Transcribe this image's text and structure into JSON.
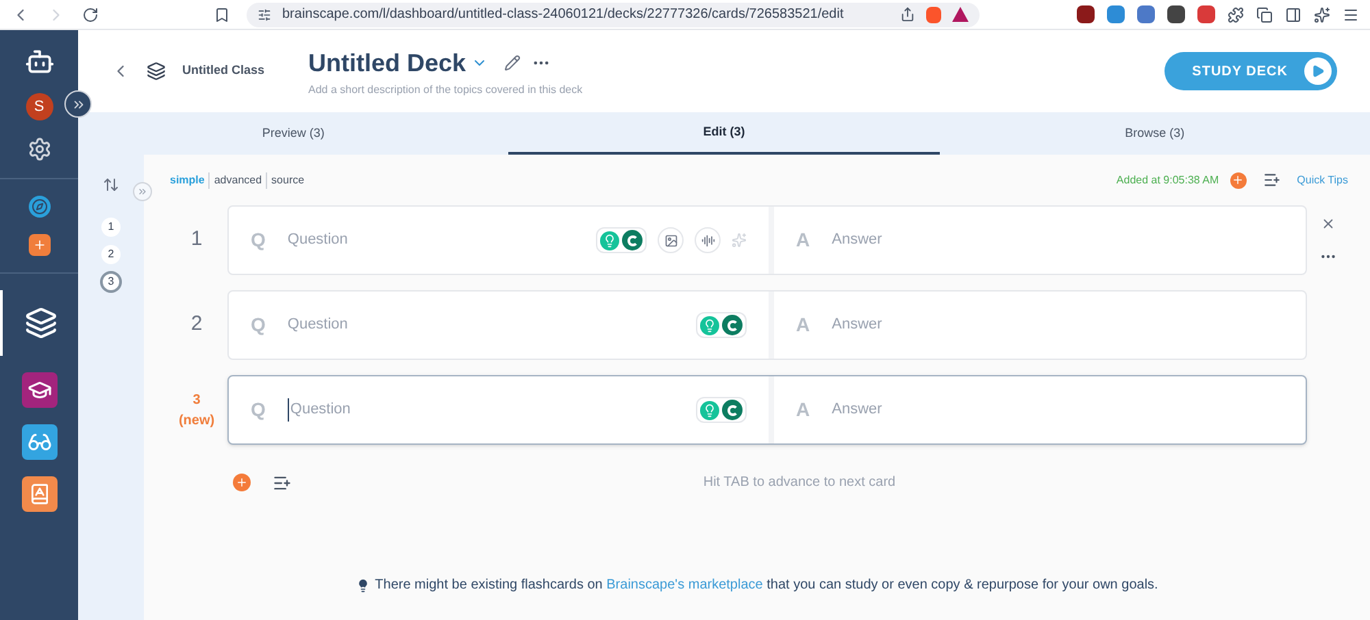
{
  "browser": {
    "url": "brainscape.com/l/dashboard/untitled-class-24060121/decks/22777326/cards/726583521/edit"
  },
  "sidebar": {
    "avatar": "S"
  },
  "header": {
    "class_name": "Untitled Class",
    "deck_title": "Untitled Deck",
    "description_placeholder": "Add a short description of the topics covered in this deck",
    "study_button": "STUDY DECK"
  },
  "tabs": [
    {
      "label": "Preview (3)",
      "selected": false
    },
    {
      "label": "Edit (3)",
      "selected": true
    },
    {
      "label": "Browse (3)",
      "selected": false
    }
  ],
  "editor_modes": [
    {
      "label": "simple",
      "selected": true
    },
    {
      "label": "advanced",
      "selected": false
    },
    {
      "label": "source",
      "selected": false
    }
  ],
  "saved_status": "Added at 9:05:38 AM",
  "quick_tips": "Quick Tips",
  "card_nav": [
    {
      "label": "1",
      "selected": false
    },
    {
      "label": "2",
      "selected": false
    },
    {
      "label": "3",
      "selected": true
    }
  ],
  "cards": [
    {
      "number": "1",
      "question_mark": "Q",
      "question_placeholder": "Question",
      "answer_mark": "A",
      "answer_placeholder": "Answer",
      "hovered": true,
      "focused": false
    },
    {
      "number": "2",
      "question_mark": "Q",
      "question_placeholder": "Question",
      "answer_mark": "A",
      "answer_placeholder": "Answer",
      "hovered": false,
      "focused": false
    },
    {
      "number": "3",
      "new_label": "(new)",
      "question_mark": "Q",
      "question_placeholder": "Question",
      "answer_mark": "A",
      "answer_placeholder": "Answer",
      "hovered": false,
      "focused": true
    }
  ],
  "hint": "Hit TAB to advance to next card",
  "footer": {
    "before": "There might be existing flashcards on ",
    "link": "Brainscape's marketplace",
    "after": " that you can study or even copy & repurpose for your own goals."
  }
}
